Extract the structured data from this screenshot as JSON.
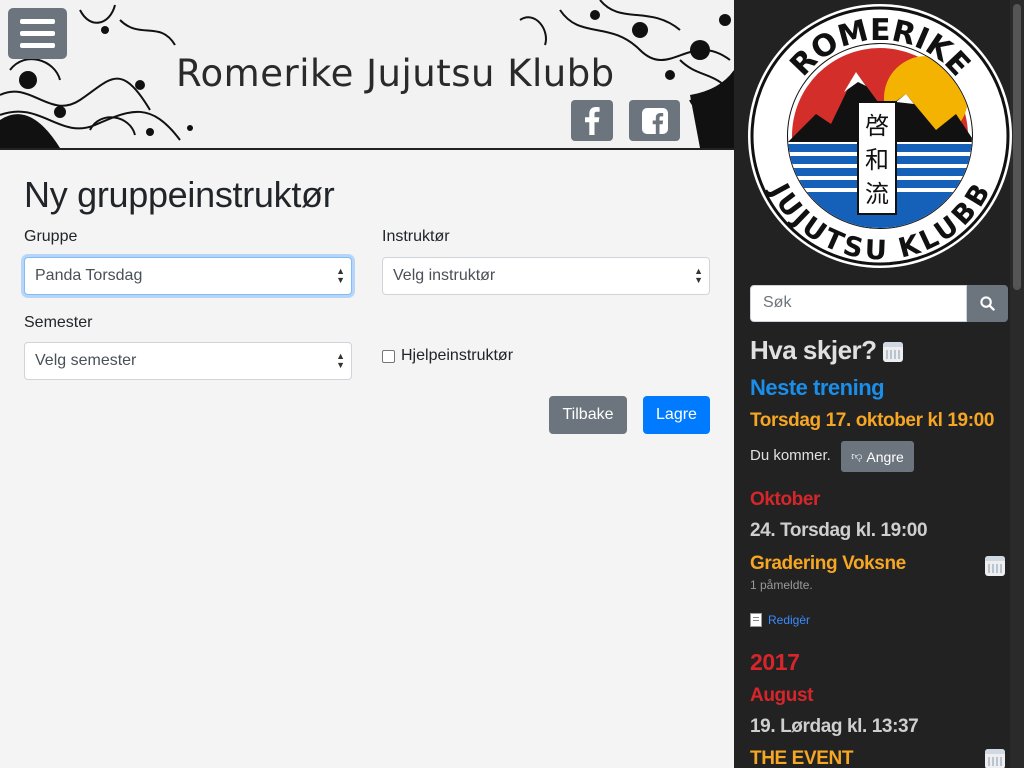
{
  "header": {
    "title": "Romerike Jujutsu Klubb",
    "menu_icon": "hamburger-icon",
    "social": [
      {
        "name": "facebook-icon"
      },
      {
        "name": "facebook-square-icon"
      }
    ]
  },
  "form": {
    "title": "Ny gruppeinstruktør",
    "group_label": "Gruppe",
    "group_value": "Panda Torsdag",
    "instructor_label": "Instruktør",
    "instructor_value": "Velg instruktør",
    "semester_label": "Semester",
    "semester_value": "Velg semester",
    "helper_label": "Hjelpeinstruktør",
    "back_label": "Tilbake",
    "save_label": "Lagre"
  },
  "sidebar": {
    "logo": {
      "top": "ROMERIKE",
      "bottom": "JUJUTSU KLUBB",
      "kanji": [
        "啓",
        "和",
        "流"
      ]
    },
    "search_placeholder": "Søk",
    "heading": "Hva skjer?",
    "next_training_label": "Neste trening",
    "next_training_date": "Torsdag 17. oktober kl 19:00",
    "attend_text": "Du kommer.",
    "undo_label": "Angre",
    "month1": "Oktober",
    "event1_date": "24. Torsdag kl. 19:00",
    "event1_title": "Gradering Voksne",
    "event1_signups": "1 påmeldte.",
    "edit_label": "Redigèr",
    "year": "2017",
    "month2": "August",
    "event2_date": "19. Lørdag kl. 13:37",
    "event2_title": "THE EVENT"
  },
  "colors": {
    "accent_blue": "#007bff",
    "secondary": "#6c757d",
    "sidebar_bg": "#222222",
    "orange": "#f6a623",
    "red": "#d7262b"
  }
}
